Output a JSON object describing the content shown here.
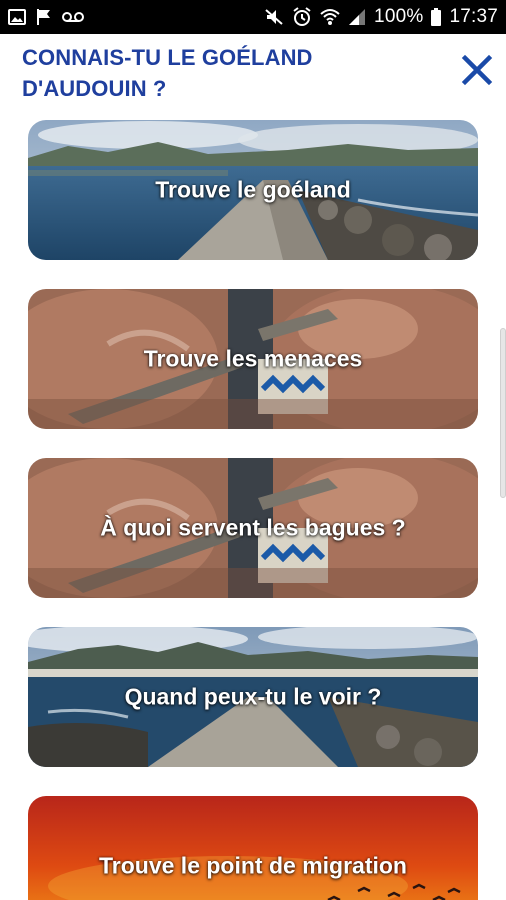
{
  "status_bar": {
    "battery": "100%",
    "time": "17:37",
    "icons": [
      "gallery-icon",
      "flag-icon",
      "voicemail-icon",
      "mute-icon",
      "alarm-icon",
      "wifi-icon",
      "signal-icon",
      "battery-icon"
    ]
  },
  "header": {
    "title": "CONNAIS-TU LE GOÉLAND D'AUDOUIN ?",
    "close_icon": "close-icon"
  },
  "cards": [
    {
      "label": "Trouve le goéland",
      "image": "harbour-jetty-photo"
    },
    {
      "label": "Trouve les menaces",
      "image": "ringed-gull-leg-photo"
    },
    {
      "label": "À quoi servent les bagues ?",
      "image": "ringed-gull-leg-photo"
    },
    {
      "label": "Quand peux-tu le voir ?",
      "image": "coastal-town-jetty-photo"
    },
    {
      "label": "Trouve le point de migration",
      "image": "sunset-birds-photo"
    }
  ],
  "colors": {
    "title": "#1f3f9e",
    "accent": "#1a4aa8"
  }
}
